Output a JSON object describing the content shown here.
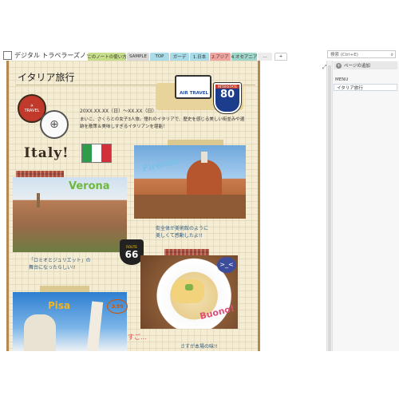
{
  "notebook": {
    "title": "デジタル トラベラーズノート",
    "caret": "▼"
  },
  "tabs": [
    {
      "label": "このノートの使い方",
      "color": "#c7dd8b"
    },
    {
      "label": "SAMPLE",
      "color": "#d8d8d8"
    },
    {
      "label": "TOP",
      "color": "#a9dbe8"
    },
    {
      "label": "ガーデ",
      "color": "#a9dbe8"
    },
    {
      "label": "1.日本",
      "color": "#a9dbe8"
    },
    {
      "label": "2.アジア",
      "color": "#f2a5a0"
    },
    {
      "label": "4.オセアニア",
      "color": "#9fd6c9"
    },
    {
      "label": "…",
      "color": "#ececec"
    },
    {
      "label": "+",
      "color": "#ffffff"
    }
  ],
  "search": {
    "placeholder": "検索 (Ctrl+E)",
    "icon": "search-icon"
  },
  "page": {
    "title": "イタリア旅行",
    "date": "20XX.XX.XX（日）～XX.XX（日）",
    "description": "まいこ、さくらとの女子3人旅。憧れのイタリアで、歴史を感じる美しい街並みや遺跡を散策＆美味しすぎるイタリアンを堪能！",
    "italy_word": "Italy!",
    "badges": {
      "travel": "TRAVEL",
      "airtravel": "AIR TRAVEL",
      "interstate": "INTERSTATE",
      "interstate_num": "80",
      "route": "ROUTE",
      "route_num": "66"
    },
    "labels": {
      "verona": "Verona",
      "firenze": "Firenze",
      "pisa": "Pisa",
      "buono": "Buono!"
    },
    "notes": {
      "romeo": "「ロミオとジュリエット」の\n舞台になったらしい!!",
      "city": "街全体が美術館のように\n美しくて感動したよ!!",
      "price": "3.99",
      "sugoi": "すご…",
      "saigo": "さすが本場の味!!"
    },
    "flag_colors": [
      "#2e9c4a",
      "#ffffff",
      "#d2303a"
    ]
  },
  "sidebar": {
    "add_page": "ページの追加",
    "section_label": "MENU",
    "pages": [
      "イタリア旅行"
    ]
  }
}
